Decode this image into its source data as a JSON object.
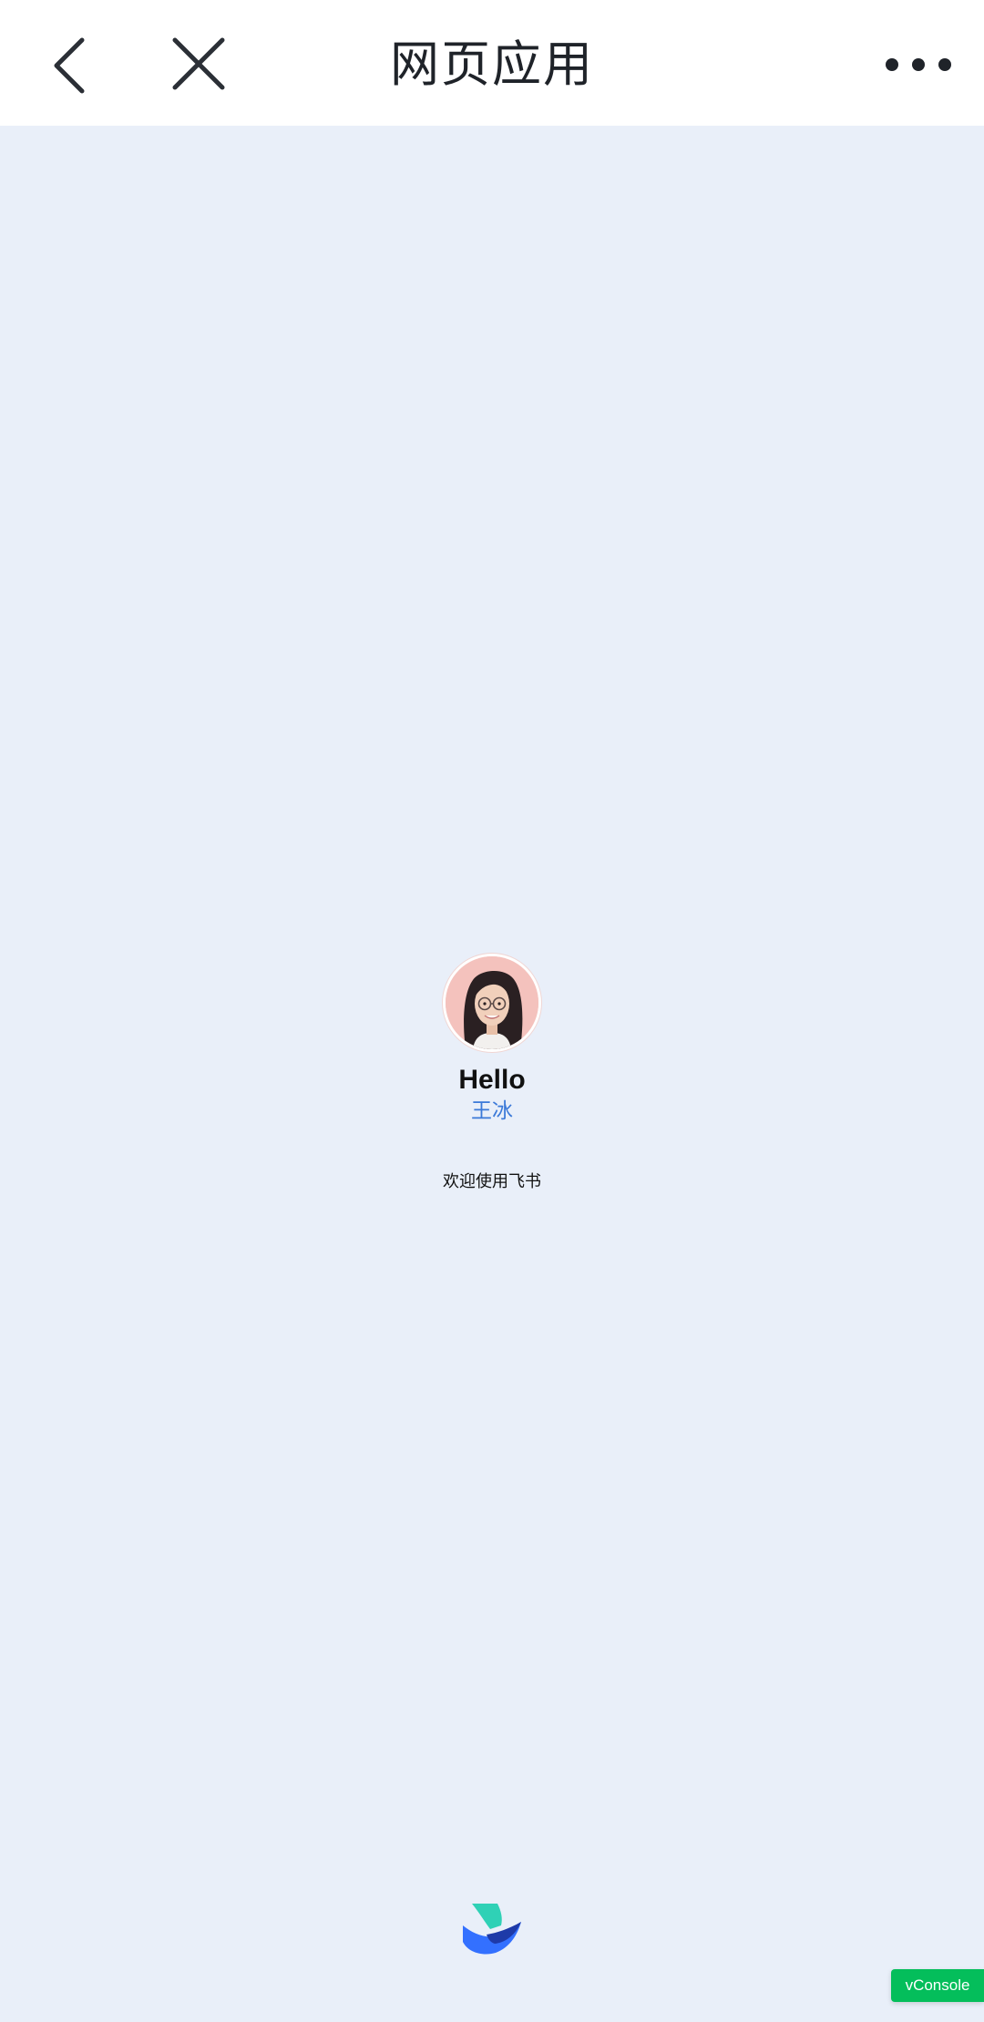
{
  "header": {
    "title": "网页应用",
    "back_icon": "chevron-left-icon",
    "close_icon": "close-icon",
    "more_icon": "more-horizontal-icon"
  },
  "profile": {
    "greeting": "Hello",
    "name": "王冰"
  },
  "welcome_text": "欢迎使用飞书",
  "vconsole_label": "vConsole",
  "colors": {
    "background": "#e9eff9",
    "header_bg": "#ffffff",
    "name_link": "#3b79d8",
    "vconsole_bg": "#04be5b"
  }
}
